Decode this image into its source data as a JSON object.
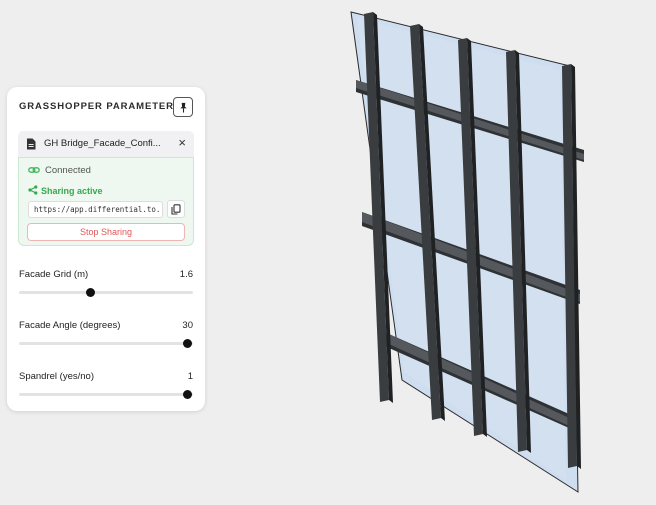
{
  "panel": {
    "title": "GRASSHOPPER PARAMETERS",
    "pin_icon": "pin-icon",
    "file_name": "GH Bridge_Facade_Confi...",
    "file_icon": "document-icon",
    "close_label": "×",
    "connection_status": "Connected",
    "sharing_status": "Sharing active",
    "share_url": "https://app.differential.to...",
    "stop_label": "Stop Sharing"
  },
  "sliders": [
    {
      "label": "Facade Grid (m)",
      "value": "1.6",
      "fraction": 0.41
    },
    {
      "label": "Facade Angle (degrees)",
      "value": "30",
      "fraction": 0.97
    },
    {
      "label": "Spandrel (yes/no)",
      "value": "1",
      "fraction": 0.97
    }
  ],
  "colors": {
    "accent_green": "#37a84e",
    "stop_red": "#e05656",
    "glass": "#c8d9ef",
    "mullion": "#3a3d40",
    "background": "#eeeeee"
  }
}
